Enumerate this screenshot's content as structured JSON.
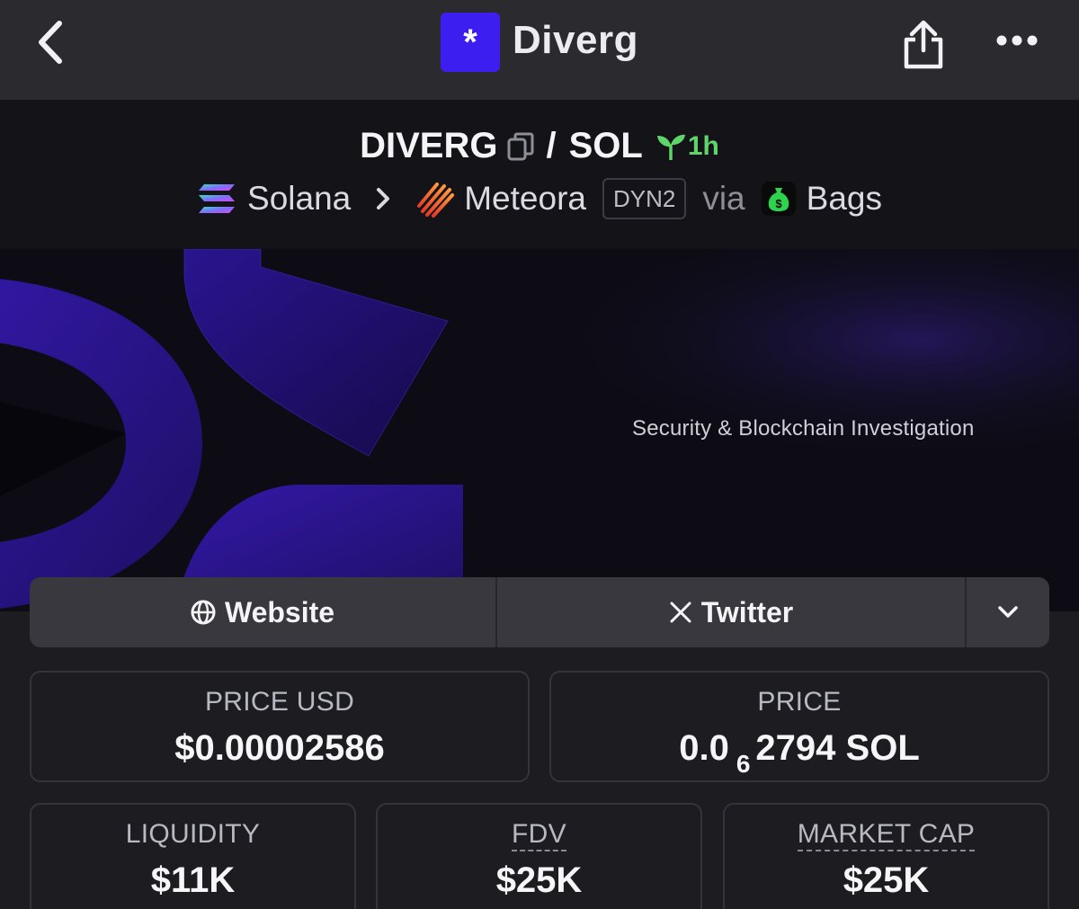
{
  "app": {
    "title": "Diverg",
    "logo_glyph": "*",
    "accent_color": "#3d1ef0"
  },
  "icons": {
    "back": "chevron-left-icon",
    "share": "share-icon",
    "more": "more-horizontal-icon",
    "copy": "copy-icon",
    "age": "sprout-icon",
    "chain": "solana-icon",
    "dex": "meteora-icon",
    "launchpad": "bags-icon",
    "website": "globe-icon",
    "twitter": "x-icon",
    "expand": "chevron-down-icon"
  },
  "pair": {
    "base": "DIVERG",
    "separator": "/",
    "quote": "SOL",
    "age": "1h",
    "age_color": "#5fd46a"
  },
  "route": {
    "chain": "Solana",
    "dex": "Meteora",
    "dex_version": "DYN2",
    "via": "via",
    "launchpad": "Bags"
  },
  "banner": {
    "tagline": "Security & Blockchain Investigation"
  },
  "links": {
    "website": "Website",
    "twitter": "Twitter"
  },
  "stats": {
    "price_usd": {
      "label": "PRICE USD",
      "value": "$0.00002586"
    },
    "price_native": {
      "label": "PRICE",
      "prefix": "0.0",
      "zeros": "6",
      "digits": "2794 SOL"
    },
    "liquidity": {
      "label": "LIQUIDITY",
      "value": "$11K"
    },
    "fdv": {
      "label": "FDV",
      "value": "$25K"
    },
    "market_cap": {
      "label": "MARKET CAP",
      "value": "$25K"
    }
  }
}
